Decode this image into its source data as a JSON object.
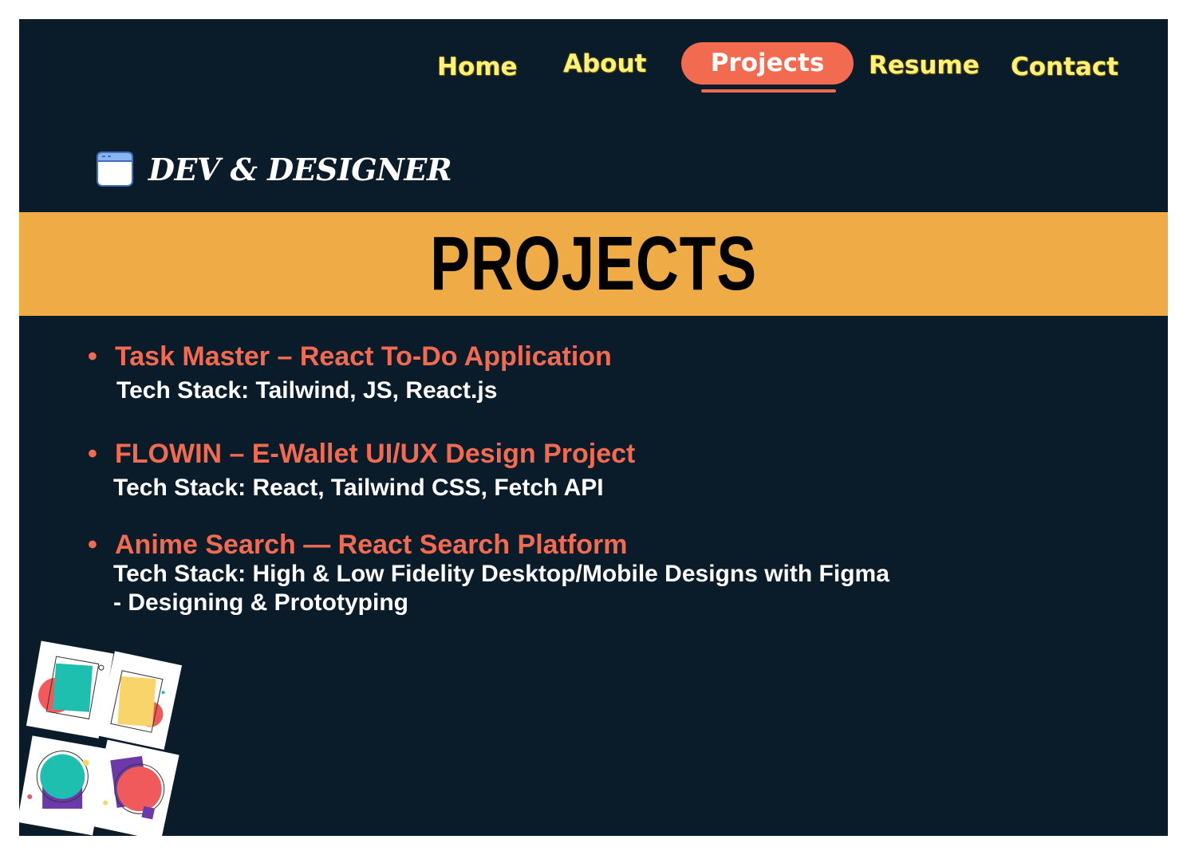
{
  "nav": {
    "items": [
      {
        "label": "Home"
      },
      {
        "label": "About"
      },
      {
        "label": "Projects",
        "active": true
      },
      {
        "label": "Resume"
      },
      {
        "label": "Contact"
      }
    ]
  },
  "logo": {
    "icon": "browser-window-icon",
    "text": "DEV & DESIGNER"
  },
  "banner": {
    "title": "PROJECTS"
  },
  "projects": [
    {
      "title": "Task Master – React To-Do Application",
      "stack": "Tech Stack:  Tailwind, JS, React.js"
    },
    {
      "title": "FLOWIN – E-Wallet UI/UX Design Project",
      "stack": "Tech Stack: React, Tailwind CSS, Fetch API"
    },
    {
      "title": "Anime Search — React Search Platform",
      "stack": "Tech Stack: High & Low Fidelity Desktop/Mobile Designs with Figma\n- Designing & Prototyping"
    }
  ],
  "bullet": "•",
  "colors": {
    "background": "#0a1c2a",
    "accent": "#f26a50",
    "banner": "#efab45",
    "nav_text": "#fff176",
    "text": "#ffffff"
  }
}
